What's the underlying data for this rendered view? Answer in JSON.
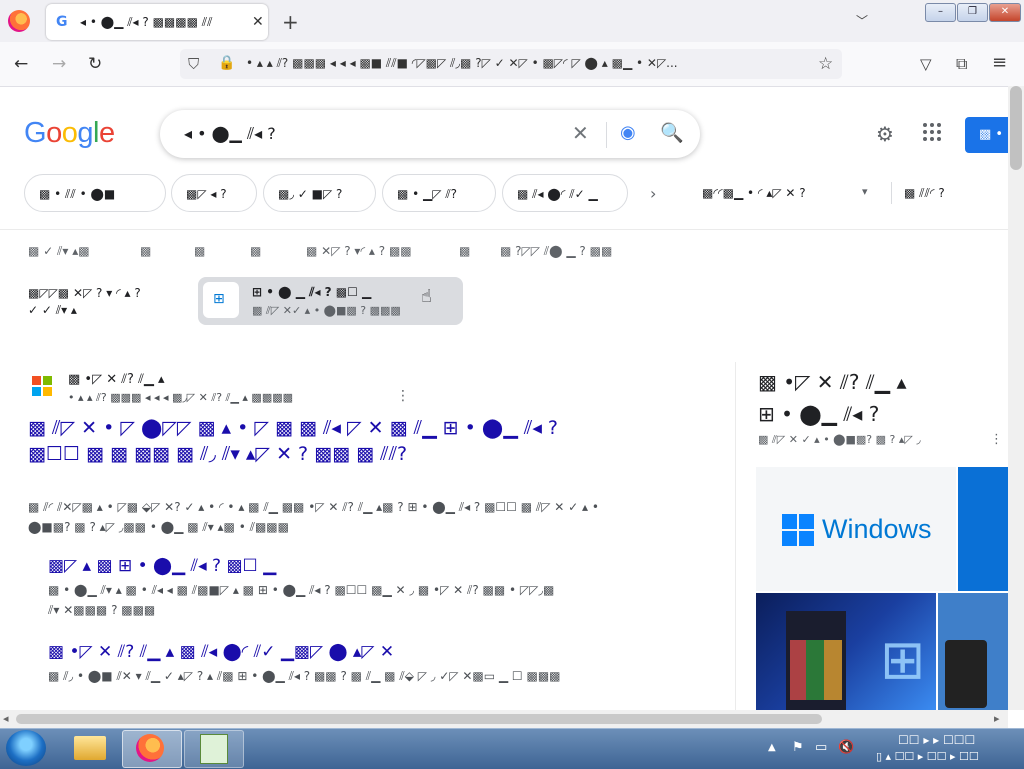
{
  "browser": {
    "tab_title": "◂ • ⬤▁ ⫽◂ ? ▩▩▩▩ ⫽⫽",
    "tab_close": "✕",
    "new_tab": "+",
    "tab_list": "﹀",
    "url": "• ▴ ▴ ⫽? ▩▩▩ ◂ ◂ ◂ ▩■ ⫽⫽■ ◜◸▩◸ ⫽◞▩ ?◸ ✓ ✕◸ • ▩◸◜ ◸ ⬤ ▴ ▩▁ • ✕◸...",
    "win_min": "–",
    "win_max": "❐",
    "win_close": "✕"
  },
  "icons": {
    "back": "←",
    "forward": "→",
    "reload": "↻",
    "shield": "⛉",
    "lock": "🔒",
    "star": "☆",
    "pocket": "▽",
    "extensions": "⧉",
    "menu": "≡",
    "clear": "✕",
    "lens": "◉",
    "search": "🔍",
    "settings": "⚙",
    "apps": "⋮⋮⋮",
    "chevron_right": "›",
    "dropdown": "▾",
    "kebab": "⋮",
    "windows": "⊞",
    "cursor": "☝"
  },
  "google": {
    "logo": "Google",
    "query": "◂ • ⬤▁ ⫽◂ ?",
    "signin": "▩ • ",
    "chips": [
      "▩ • ⫽⫽ • ⬤■",
      "▩◸ ◂ ?",
      "▩◞ ✓ ■◸ ?",
      "▩ • ▁◸ ⫽?",
      "▩ ⫽◂ ⬤◜ ⫽✓ ▁"
    ],
    "filter1": "▩◜◜▩▁ • ◜ ▴◸ ✕ ?",
    "filter2": "▩ ⫽⫽◜ ?",
    "tools": [
      "▩ ✓ ⫽▾ ▴▩",
      "▩",
      "▩",
      "▩",
      "▩ ✕◸ ? ▾◜ ▴ ? ▩▩",
      "▩",
      "▩ ?◸◸ ⫽⬤ ▁ ? ▩▩"
    ],
    "people_also": "▩◸◸▩ ✕◸ ? ▾ ◜ ▴ ?\n✓ ✓ ⫽▾ ▴",
    "suggestion": {
      "title": "⊞ • ⬤ ▁ ⫽◂ ? ▩☐ ▁",
      "subtitle": "▩ ⫽◸ ✕✓ ▴ • ⬤■▩ ? ▩▩▩"
    }
  },
  "result": {
    "site": "▩ •◸ ✕ ⫽? ⫽▁ ▴",
    "cite": "• ▴ ▴ ⫽? ▩▩▩ ◂ ◂ ◂ ▩◞◸ ✕ ⫽? ⫽▁ ▴ ▩▩▩▩",
    "title": "▩ ⫽◸ ✕ • ◸ ⬤◸◸ ▩ ▴ • ◸ ▩ ▩ ⫽◂ ◸ ✕ ▩ ⫽▁ ⊞ • ⬤▁ ⫽◂ ? ▩☐☐ ▩ ▩ ▩▩ ▩ ⫽◞ ⫽▾ ▴◸ ✕ ? ▩▩ ▩ ⫽⫽?",
    "snippet": "▩ ⫽◜ ⫽✕◸▩ ▴ • ◸▩ ⬙◸ ✕? ✓ ▴ • ◜ • ▴ ▩ ⫽▁ ▩▩ •◸ ✕ ⫽? ⫽▁ ▴▩ ? ⊞ • ⬤▁ ⫽◂ ? ▩☐☐ ▩ ⫽◸ ✕ ✓ ▴ • ⬤■▩? ▩ ? ▴◸ ◞▩▩ • ⬤▁ ▩ ⫽▾ ▴▩ • ⫽▩▩▩",
    "sub1_title": "▩◸ ▴ ▩ ⊞ • ⬤▁ ⫽◂ ? ▩☐ ▁",
    "sub1_snip": "▩ • ⬤▁ ⫽▾ ▴ ▩ • ⫽◂ ◂ ▩ ⫽▩■◸ ▴ ▩ ⊞ • ⬤▁ ⫽◂ ? ▩☐☐ ▩▁ ✕ ◞ ▩ •◸ ✕ ⫽? ▩▩ • ◸◸◞▩ ⫽▾ ✕▩▩▩ ? ▩▩▩",
    "sub2_title": "▩ •◸ ✕ ⫽? ⫽▁ ▴ ▩ ⫽◂ ⬤◜ ⫽✓ ▁▩◸ ⬤ ▴◸ ✕",
    "sub2_snip": "▩ ⫽◞ • ⬤■ ⫽✕ ▾ ⫽▁ ✓ ▴◸ ? ▴ ⫽▩ ⊞ • ⬤▁ ⫽◂ ? ▩▩ ? ▩ ⫽▁ ▩ ⫽⬙ ◸ ◞ ✓◸ ✕▩▭ ▁ ☐ ▩▩▩"
  },
  "panel": {
    "title": "▩ •◸ ✕ ⫽? ⫽▁ ▴\n⊞ • ⬤▁ ⫽◂ ?",
    "subtitle": "▩ ⫽◸ ✕ ✓ ▴ • ⬤■▩? ▩ ? ▴◸ ◞",
    "image_brand": "Windows"
  },
  "scroll": {
    "left": "◂",
    "right": "▸"
  },
  "taskbar": {
    "tray_up": "▲",
    "tray_icons": [
      "⚑",
      "▭",
      "🔇"
    ],
    "clock_time": "☐☐ ▸ ▸ ☐☐☐",
    "clock_date": "▯ ▴ ☐☐ ▸ ☐☐ ▸ ☐☐"
  },
  "colors": {
    "link": "#1a0dab",
    "accent": "#1a73e8",
    "windows_blue": "#0078d4"
  }
}
